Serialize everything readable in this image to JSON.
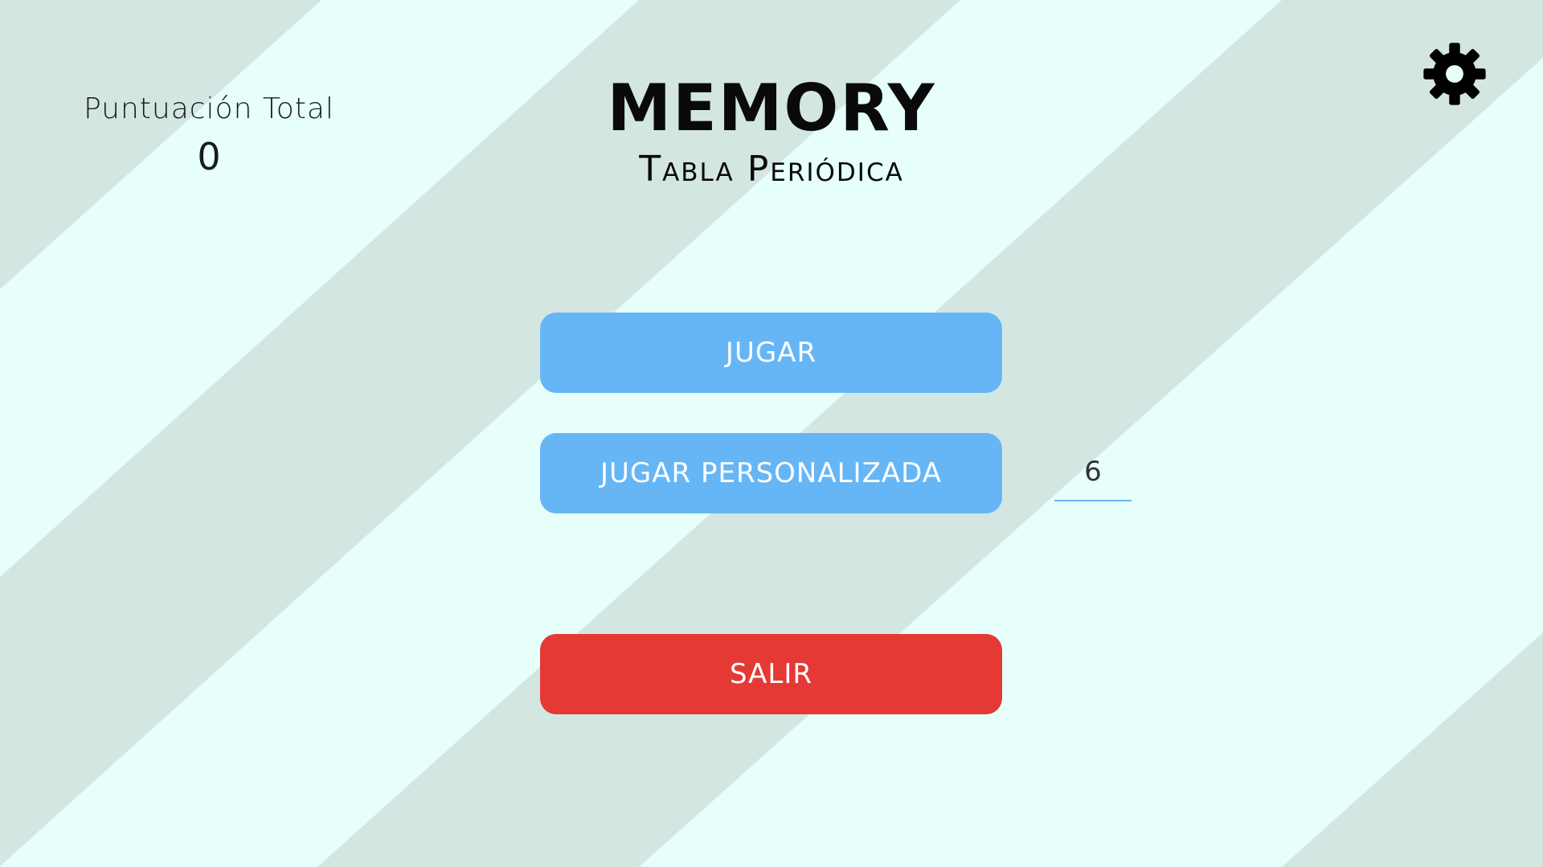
{
  "background": {
    "base_color": "#e6fffb",
    "stripe_color": "#d3e6e2"
  },
  "score": {
    "label": "Puntuación Total",
    "value": "0"
  },
  "header": {
    "title": "MEMORY",
    "subtitle": "Tabla Periódica"
  },
  "settings": {
    "icon": "gear-icon",
    "color": "#000000"
  },
  "menu": {
    "play_label": "JUGAR",
    "custom_play_label": "JUGAR PERSONALIZADA",
    "custom_pairs_value": "6",
    "exit_label": "SALIR"
  },
  "colors": {
    "primary_button": "#66b6f6",
    "exit_button": "#e53935"
  }
}
